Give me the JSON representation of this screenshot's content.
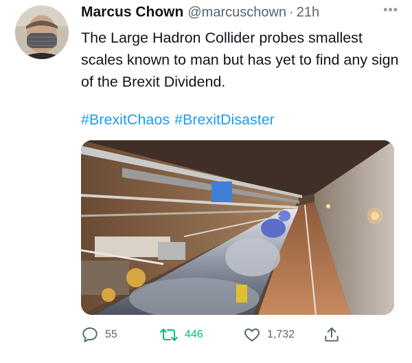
{
  "author": {
    "name": "Marcus Chown",
    "handle": "@marcuschown",
    "separator": "·",
    "time": "21h",
    "more_icon": "more-dots-icon"
  },
  "tweet": {
    "text": "The Large Hadron Collider probes smallest scales known to man but has yet to find any sign of the Brexit Dividend.",
    "hashtags": [
      "#BrexitChaos",
      "#BrexitDisaster"
    ]
  },
  "actions": {
    "replies": "55",
    "retweets": "446",
    "likes": "1,732",
    "reply_icon": "reply-bubble-icon",
    "retweet_icon": "retweet-icon",
    "like_icon": "heart-icon",
    "share_icon": "share-icon"
  },
  "colors": {
    "link": "#1d9bf0",
    "muted": "#536471",
    "retweet_active": "#00ba7c",
    "text": "#0f1419"
  }
}
